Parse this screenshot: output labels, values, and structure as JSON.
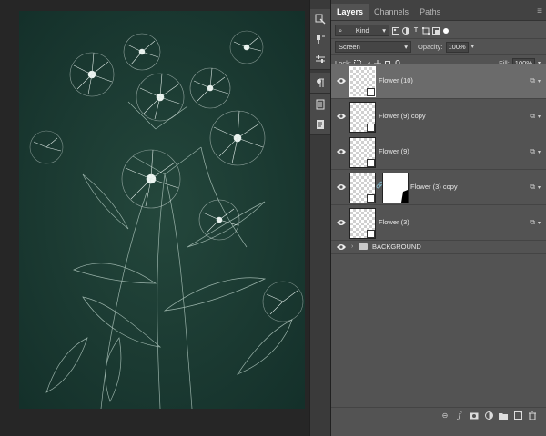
{
  "panel": {
    "tabs": [
      {
        "label": "Layers"
      },
      {
        "label": "Channels"
      },
      {
        "label": "Paths"
      }
    ],
    "filter": {
      "label": "Kind"
    },
    "blend_mode": "Screen",
    "opacity_label": "Opacity:",
    "opacity_value": "100%",
    "lock_label": "Lock:",
    "fill_label": "Fill:",
    "fill_value": "100%"
  },
  "layers": [
    {
      "name": "Flower (10)",
      "selected": true
    },
    {
      "name": "Flower (9) copy"
    },
    {
      "name": "Flower (9)"
    },
    {
      "name": "Flower (3) copy",
      "has_mask": true
    },
    {
      "name": "Flower (3)"
    },
    {
      "name": "BACKGROUND",
      "type": "group"
    }
  ],
  "icons": {
    "tools": [
      "history-brush-icon",
      "brush-settings-icon",
      "adjustments-icon",
      "paragraph-icon",
      "properties-icon",
      "notes-icon"
    ],
    "bottom_bar": [
      "link-icon",
      "fx-icon",
      "mask-icon",
      "adjustment-layer-icon",
      "group-icon",
      "new-layer-icon",
      "trash-icon"
    ]
  },
  "colors": {
    "canvas_bg": "#1b3a31",
    "panel_bg": "#535353",
    "selected_row": "#6b6b6b"
  }
}
